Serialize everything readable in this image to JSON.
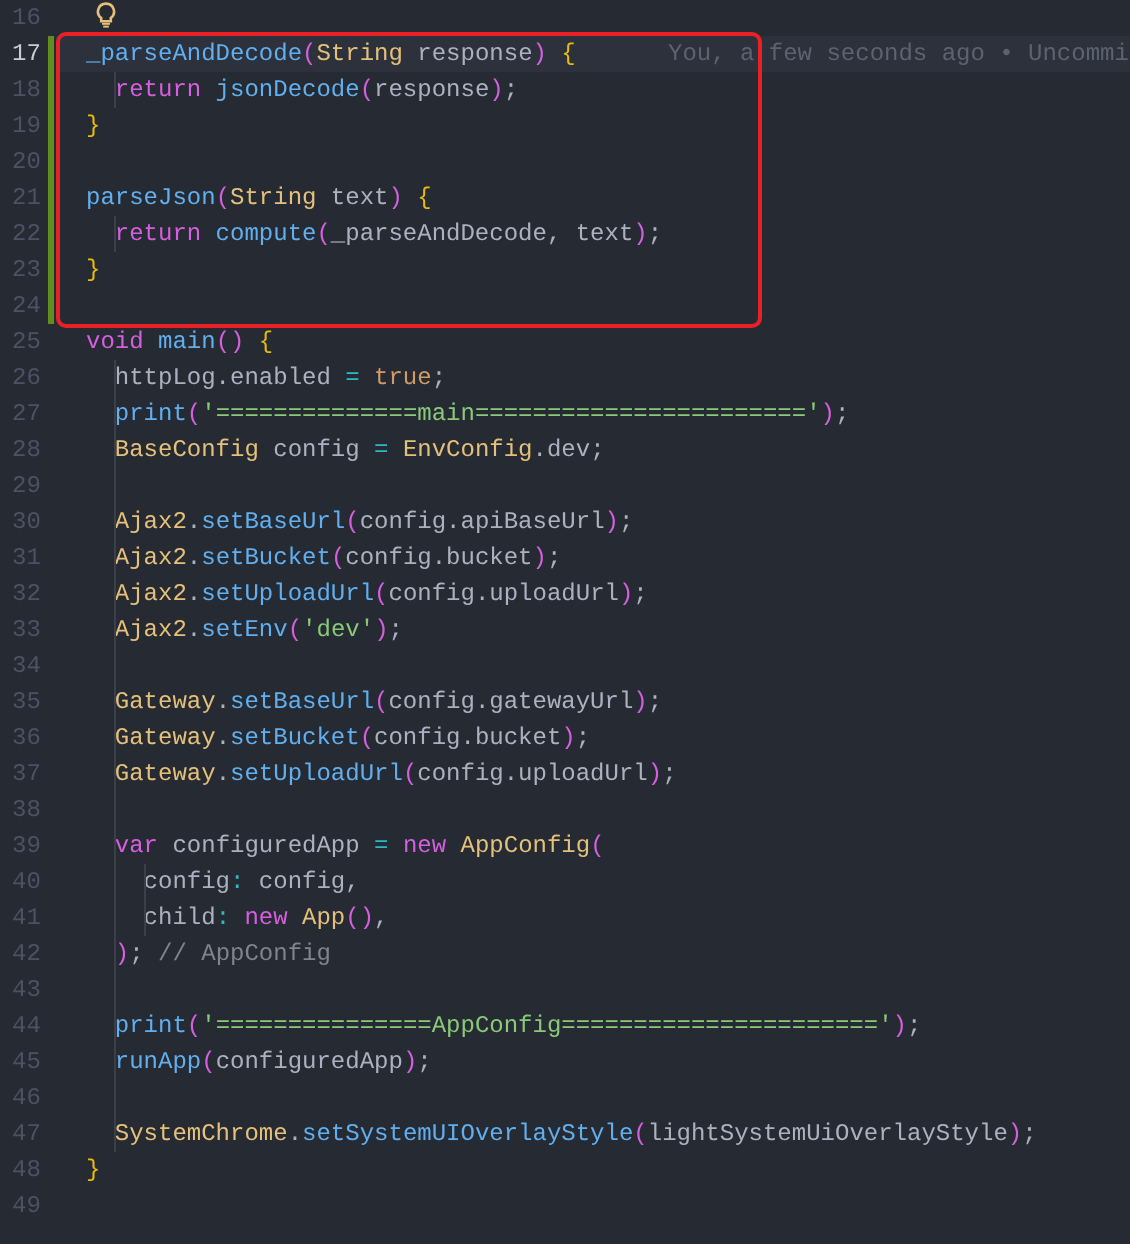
{
  "blocks": [
    {
      "boxed": false,
      "lines": [
        {
          "number": "16",
          "changed": false,
          "current": false
        }
      ]
    },
    {
      "boxed": true,
      "lines": [
        {
          "number": "17",
          "changed": true,
          "current": true,
          "blame": "You, a few seconds ago • Uncommi",
          "tokens": [
            {
              "text": "_parseAndDecode",
              "kind": "function"
            },
            {
              "text": "(",
              "kind": "paren"
            },
            {
              "text": "String",
              "kind": "type"
            },
            {
              "text": " response",
              "kind": "text"
            },
            {
              "text": ")",
              "kind": "paren"
            },
            {
              "text": " {",
              "kind": "brace"
            }
          ]
        },
        {
          "number": "18",
          "changed": true,
          "current": false,
          "tokens": [
            {
              "text": "  return",
              "kind": "keyword"
            },
            {
              "text": " jsonDecode",
              "kind": "function"
            },
            {
              "text": "(",
              "kind": "paren"
            },
            {
              "text": "response",
              "kind": "text"
            },
            {
              "text": ")",
              "kind": "paren"
            },
            {
              "text": ";",
              "kind": "text"
            }
          ]
        },
        {
          "number": "19",
          "changed": true,
          "current": false,
          "tokens": [
            {
              "text": "}",
              "kind": "brace"
            }
          ]
        },
        {
          "number": "20",
          "changed": true,
          "current": false
        },
        {
          "number": "21",
          "changed": true,
          "current": false,
          "tokens": [
            {
              "text": "parseJson",
              "kind": "function"
            },
            {
              "text": "(",
              "kind": "paren"
            },
            {
              "text": "String",
              "kind": "type"
            },
            {
              "text": " text",
              "kind": "text"
            },
            {
              "text": ")",
              "kind": "paren"
            },
            {
              "text": " {",
              "kind": "brace"
            }
          ]
        },
        {
          "number": "22",
          "changed": true,
          "current": false,
          "tokens": [
            {
              "text": "  return",
              "kind": "keyword"
            },
            {
              "text": " compute",
              "kind": "function"
            },
            {
              "text": "(",
              "kind": "paren"
            },
            {
              "text": "_parseAndDecode, text",
              "kind": "text"
            },
            {
              "text": ")",
              "kind": "paren"
            },
            {
              "text": ";",
              "kind": "text"
            }
          ]
        },
        {
          "number": "23",
          "changed": true,
          "current": false,
          "tokens": [
            {
              "text": "}",
              "kind": "brace"
            }
          ]
        },
        {
          "number": "24",
          "changed": true,
          "current": false
        }
      ]
    },
    {
      "boxed": false,
      "lines": [
        {
          "number": "25",
          "changed": false,
          "current": false,
          "tokens": [
            {
              "text": "void",
              "kind": "keyword"
            },
            {
              "text": " main",
              "kind": "function"
            },
            {
              "text": "()",
              "kind": "paren"
            },
            {
              "text": " {",
              "kind": "brace"
            }
          ]
        },
        {
          "number": "26",
          "changed": false,
          "current": false,
          "tokens": [
            {
              "text": "  httpLog.enabled",
              "kind": "text"
            },
            {
              "text": " =",
              "kind": "operator"
            },
            {
              "text": " true",
              "kind": "literal"
            },
            {
              "text": ";",
              "kind": "text"
            }
          ]
        },
        {
          "number": "27",
          "changed": false,
          "current": false,
          "tokens": [
            {
              "text": "  print",
              "kind": "function"
            },
            {
              "text": "(",
              "kind": "paren"
            },
            {
              "text": "'==============main======================='",
              "kind": "string"
            },
            {
              "text": ")",
              "kind": "paren"
            },
            {
              "text": ";",
              "kind": "text"
            }
          ]
        },
        {
          "number": "28",
          "changed": false,
          "current": false,
          "tokens": [
            {
              "text": "  BaseConfig",
              "kind": "type"
            },
            {
              "text": " config",
              "kind": "text"
            },
            {
              "text": " =",
              "kind": "operator"
            },
            {
              "text": " EnvConfig",
              "kind": "type"
            },
            {
              "text": ".dev;",
              "kind": "text"
            }
          ]
        },
        {
          "number": "29",
          "changed": false,
          "current": false
        },
        {
          "number": "30",
          "changed": false,
          "current": false,
          "tokens": [
            {
              "text": "  Ajax2",
              "kind": "type"
            },
            {
              "text": ".",
              "kind": "text"
            },
            {
              "text": "setBaseUrl",
              "kind": "function"
            },
            {
              "text": "(",
              "kind": "paren"
            },
            {
              "text": "config.apiBaseUrl",
              "kind": "text"
            },
            {
              "text": ")",
              "kind": "paren"
            },
            {
              "text": ";",
              "kind": "text"
            }
          ]
        },
        {
          "number": "31",
          "changed": false,
          "current": false,
          "tokens": [
            {
              "text": "  Ajax2",
              "kind": "type"
            },
            {
              "text": ".",
              "kind": "text"
            },
            {
              "text": "setBucket",
              "kind": "function"
            },
            {
              "text": "(",
              "kind": "paren"
            },
            {
              "text": "config.bucket",
              "kind": "text"
            },
            {
              "text": ")",
              "kind": "paren"
            },
            {
              "text": ";",
              "kind": "text"
            }
          ]
        },
        {
          "number": "32",
          "changed": false,
          "current": false,
          "tokens": [
            {
              "text": "  Ajax2",
              "kind": "type"
            },
            {
              "text": ".",
              "kind": "text"
            },
            {
              "text": "setUploadUrl",
              "kind": "function"
            },
            {
              "text": "(",
              "kind": "paren"
            },
            {
              "text": "config.uploadUrl",
              "kind": "text"
            },
            {
              "text": ")",
              "kind": "paren"
            },
            {
              "text": ";",
              "kind": "text"
            }
          ]
        },
        {
          "number": "33",
          "changed": false,
          "current": false,
          "tokens": [
            {
              "text": "  Ajax2",
              "kind": "type"
            },
            {
              "text": ".",
              "kind": "text"
            },
            {
              "text": "setEnv",
              "kind": "function"
            },
            {
              "text": "(",
              "kind": "paren"
            },
            {
              "text": "'dev'",
              "kind": "string"
            },
            {
              "text": ")",
              "kind": "paren"
            },
            {
              "text": ";",
              "kind": "text"
            }
          ]
        },
        {
          "number": "34",
          "changed": false,
          "current": false
        },
        {
          "number": "35",
          "changed": false,
          "current": false,
          "tokens": [
            {
              "text": "  Gateway",
              "kind": "type"
            },
            {
              "text": ".",
              "kind": "text"
            },
            {
              "text": "setBaseUrl",
              "kind": "function"
            },
            {
              "text": "(",
              "kind": "paren"
            },
            {
              "text": "config.gatewayUrl",
              "kind": "text"
            },
            {
              "text": ")",
              "kind": "paren"
            },
            {
              "text": ";",
              "kind": "text"
            }
          ]
        },
        {
          "number": "36",
          "changed": false,
          "current": false,
          "tokens": [
            {
              "text": "  Gateway",
              "kind": "type"
            },
            {
              "text": ".",
              "kind": "text"
            },
            {
              "text": "setBucket",
              "kind": "function"
            },
            {
              "text": "(",
              "kind": "paren"
            },
            {
              "text": "config.bucket",
              "kind": "text"
            },
            {
              "text": ")",
              "kind": "paren"
            },
            {
              "text": ";",
              "kind": "text"
            }
          ]
        },
        {
          "number": "37",
          "changed": false,
          "current": false,
          "tokens": [
            {
              "text": "  Gateway",
              "kind": "type"
            },
            {
              "text": ".",
              "kind": "text"
            },
            {
              "text": "setUploadUrl",
              "kind": "function"
            },
            {
              "text": "(",
              "kind": "paren"
            },
            {
              "text": "config.uploadUrl",
              "kind": "text"
            },
            {
              "text": ")",
              "kind": "paren"
            },
            {
              "text": ";",
              "kind": "text"
            }
          ]
        },
        {
          "number": "38",
          "changed": false,
          "current": false
        },
        {
          "number": "39",
          "changed": false,
          "current": false,
          "tokens": [
            {
              "text": "  var",
              "kind": "keyword"
            },
            {
              "text": " configuredApp",
              "kind": "text"
            },
            {
              "text": " =",
              "kind": "operator"
            },
            {
              "text": " new",
              "kind": "keyword"
            },
            {
              "text": " AppConfig",
              "kind": "type"
            },
            {
              "text": "(",
              "kind": "paren"
            }
          ]
        },
        {
          "number": "40",
          "changed": false,
          "current": false,
          "tokens": [
            {
              "text": "    config",
              "kind": "text"
            },
            {
              "text": ":",
              "kind": "operator"
            },
            {
              "text": " config,",
              "kind": "text"
            }
          ]
        },
        {
          "number": "41",
          "changed": false,
          "current": false,
          "tokens": [
            {
              "text": "    child",
              "kind": "text"
            },
            {
              "text": ":",
              "kind": "operator"
            },
            {
              "text": " new",
              "kind": "keyword"
            },
            {
              "text": " App",
              "kind": "type"
            },
            {
              "text": "()",
              "kind": "paren"
            },
            {
              "text": ",",
              "kind": "text"
            }
          ]
        },
        {
          "number": "42",
          "changed": false,
          "current": false,
          "tokens": [
            {
              "text": "  )",
              "kind": "paren"
            },
            {
              "text": ";",
              "kind": "text"
            },
            {
              "text": " // AppConfig",
              "kind": "comment"
            }
          ]
        },
        {
          "number": "43",
          "changed": false,
          "current": false
        },
        {
          "number": "44",
          "changed": false,
          "current": false,
          "tokens": [
            {
              "text": "  print",
              "kind": "function"
            },
            {
              "text": "(",
              "kind": "paren"
            },
            {
              "text": "'===============AppConfig======================'",
              "kind": "string"
            },
            {
              "text": ")",
              "kind": "paren"
            },
            {
              "text": ";",
              "kind": "text"
            }
          ]
        },
        {
          "number": "45",
          "changed": false,
          "current": false,
          "tokens": [
            {
              "text": "  runApp",
              "kind": "function"
            },
            {
              "text": "(",
              "kind": "paren"
            },
            {
              "text": "configuredApp",
              "kind": "text"
            },
            {
              "text": ")",
              "kind": "paren"
            },
            {
              "text": ";",
              "kind": "text"
            }
          ]
        },
        {
          "number": "46",
          "changed": false,
          "current": false
        },
        {
          "number": "47",
          "changed": false,
          "current": false,
          "tokens": [
            {
              "text": "  SystemChrome",
              "kind": "type"
            },
            {
              "text": ".",
              "kind": "text"
            },
            {
              "text": "setSystemUIOverlayStyle",
              "kind": "function"
            },
            {
              "text": "(",
              "kind": "paren"
            },
            {
              "text": "lightSystemUiOverlayStyle",
              "kind": "text"
            },
            {
              "text": ")",
              "kind": "paren"
            },
            {
              "text": ";",
              "kind": "text"
            }
          ]
        },
        {
          "number": "48",
          "changed": false,
          "current": false,
          "tokens": [
            {
              "text": "}",
              "kind": "brace"
            }
          ]
        },
        {
          "number": "49",
          "changed": false,
          "current": false
        }
      ]
    }
  ]
}
